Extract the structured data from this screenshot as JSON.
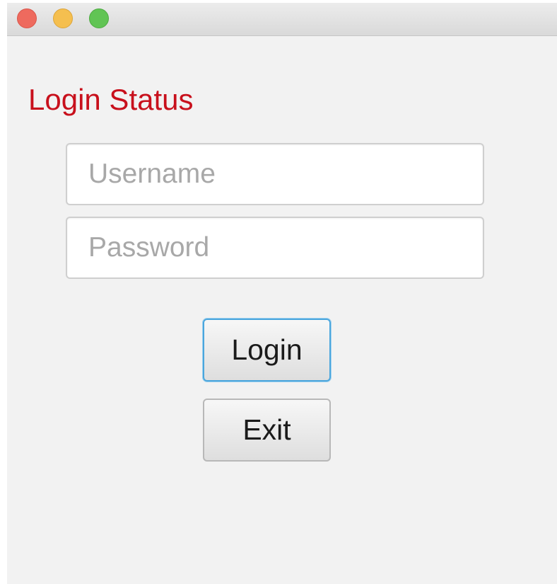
{
  "window": {
    "controls": {
      "close_icon": "close-traffic-light",
      "minimize_icon": "minimize-traffic-light",
      "zoom_icon": "zoom-traffic-light",
      "close_color": "#ee6a5e",
      "minimize_color": "#f5bf4f",
      "zoom_color": "#61c454"
    }
  },
  "login": {
    "status_text": "Login Status",
    "status_color": "#c8101c",
    "username": {
      "value": "",
      "placeholder": "Username"
    },
    "password": {
      "value": "",
      "placeholder": "Password"
    },
    "login_button_label": "Login",
    "exit_button_label": "Exit",
    "focus_color": "#4aa6dd"
  }
}
